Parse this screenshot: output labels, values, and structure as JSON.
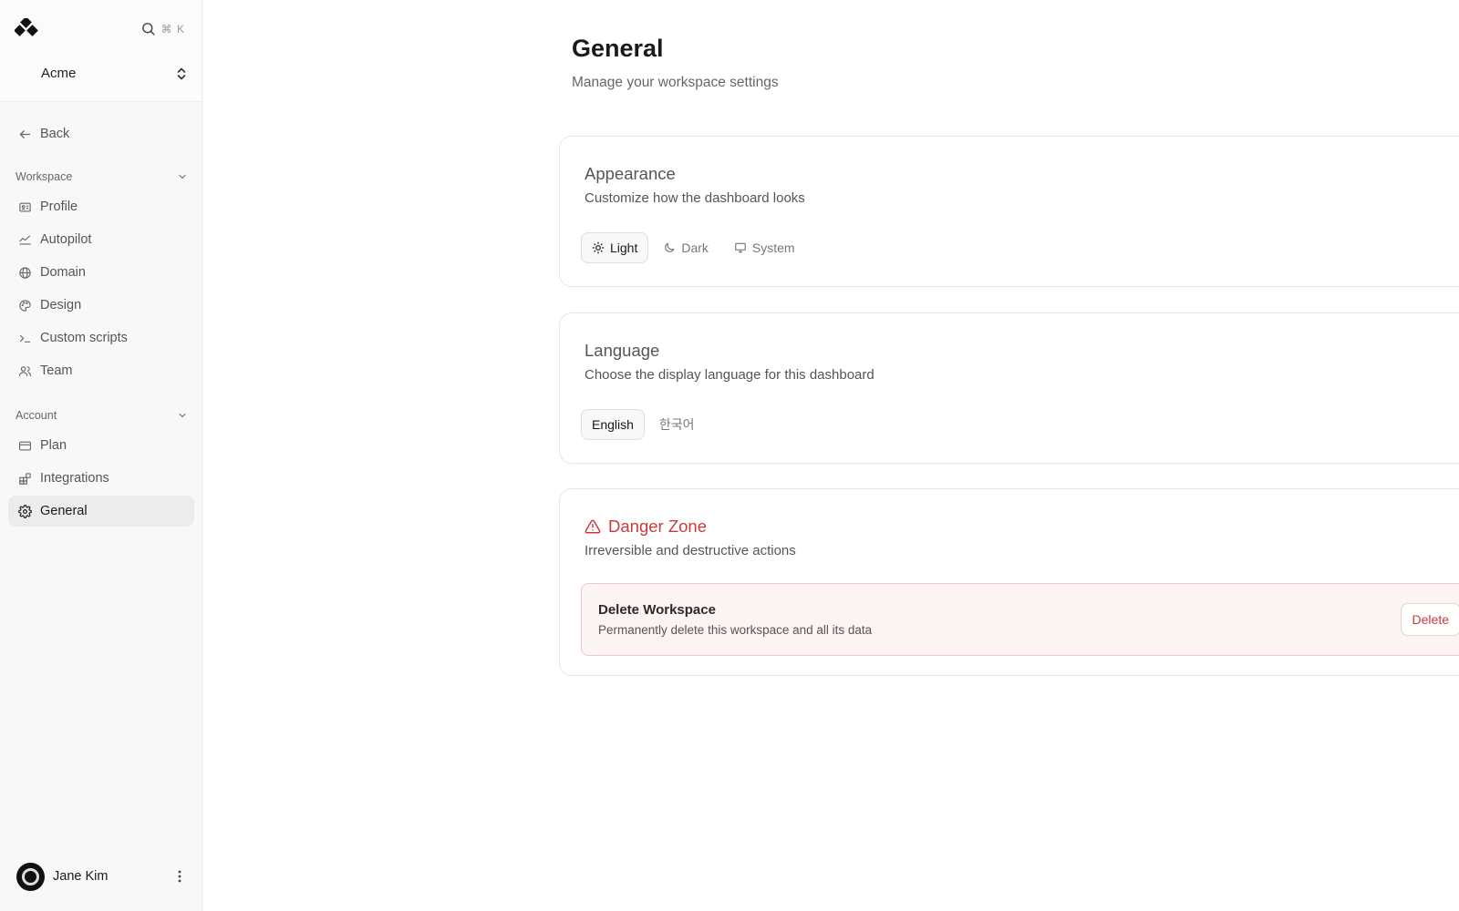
{
  "sidebar": {
    "org_name": "Acme",
    "search_shortcut": "⌘ K",
    "back_label": "Back",
    "sections": [
      {
        "title": "Workspace",
        "items": [
          {
            "label": "Profile",
            "icon": "id-card-icon"
          },
          {
            "label": "Autopilot",
            "icon": "autopilot-icon"
          },
          {
            "label": "Domain",
            "icon": "globe-icon"
          },
          {
            "label": "Design",
            "icon": "palette-icon"
          },
          {
            "label": "Custom scripts",
            "icon": "terminal-icon"
          },
          {
            "label": "Team",
            "icon": "users-icon"
          }
        ]
      },
      {
        "title": "Account",
        "items": [
          {
            "label": "Plan",
            "icon": "credit-card-icon"
          },
          {
            "label": "Integrations",
            "icon": "blocks-icon"
          },
          {
            "label": "General",
            "icon": "gear-icon",
            "active": true
          }
        ]
      }
    ],
    "user": {
      "name": "Jane Kim"
    }
  },
  "main": {
    "title": "General",
    "subtitle": "Manage your workspace settings",
    "appearance": {
      "title": "Appearance",
      "description": "Customize how the dashboard looks",
      "options": [
        {
          "label": "Light",
          "icon": "sun-icon",
          "selected": true
        },
        {
          "label": "Dark",
          "icon": "moon-icon",
          "selected": false
        },
        {
          "label": "System",
          "icon": "monitor-icon",
          "selected": false
        }
      ]
    },
    "language": {
      "title": "Language",
      "description": "Choose the display language for this dashboard",
      "options": [
        {
          "label": "English",
          "selected": true
        },
        {
          "label": "한국어",
          "selected": false
        }
      ]
    },
    "danger": {
      "title": "Danger Zone",
      "description": "Irreversible and destructive actions",
      "item_title": "Delete Workspace",
      "item_description": "Permanently delete this workspace and all its data",
      "button_label": "Delete"
    }
  },
  "colors": {
    "danger": "#c93b3b",
    "active_nav_bg": "#ececec",
    "sidebar_bg": "#f8f8f8"
  }
}
